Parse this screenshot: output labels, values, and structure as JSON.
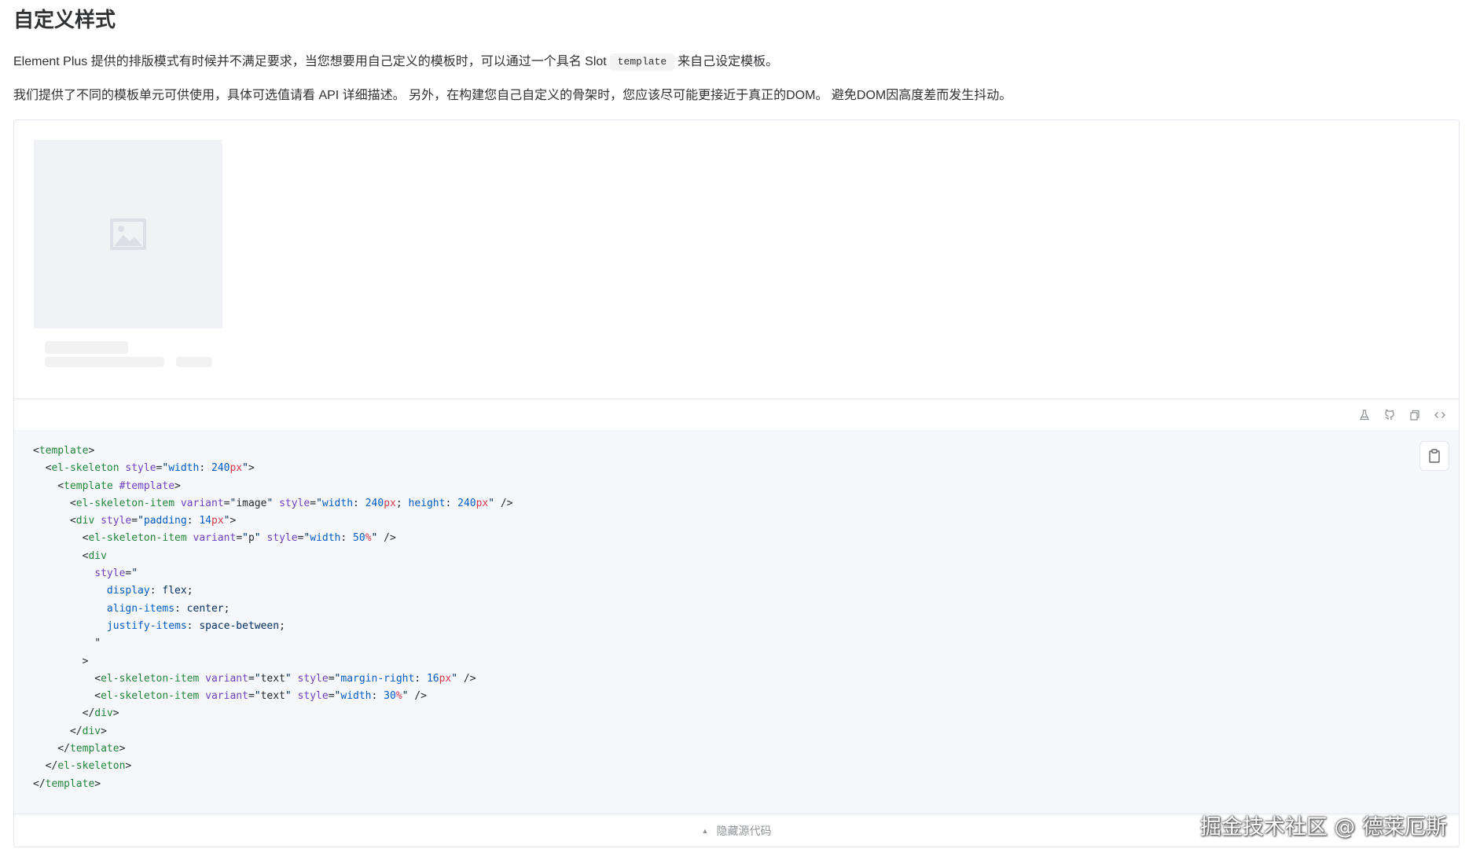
{
  "page": {
    "title": "自定义样式",
    "intro_before": "Element Plus 提供的排版模式有时候并不满足要求，当您想要用自己定义的模板时，可以通过一个具名 Slot",
    "intro_code": "template",
    "intro_after": "来自己设定模板。",
    "paragraph2": "我们提供了不同的模板单元可供使用，具体可选值请看 API 详细描述。 另外，在构建您自己自定义的骨架时，您应该尽可能更接近于真正的DOM。 避免DOM因高度差而发生抖动。"
  },
  "demo": {
    "toolbar_icons": [
      "flask-icon",
      "github-icon",
      "copy-icon",
      "code-icon"
    ],
    "code_lines": [
      "<template>",
      "  <el-skeleton style=\"width: 240px\">",
      "    <template #template>",
      "      <el-skeleton-item variant=\"image\" style=\"width: 240px; height: 240px\" />",
      "      <div style=\"padding: 14px\">",
      "        <el-skeleton-item variant=\"p\" style=\"width: 50%\" />",
      "        <div",
      "          style=\"",
      "            display: flex;",
      "            align-items: center;",
      "            justify-items: space-between;",
      "          \"",
      "        >",
      "          <el-skeleton-item variant=\"text\" style=\"margin-right: 16px\" />",
      "          <el-skeleton-item variant=\"text\" style=\"width: 30%\" />",
      "        </div>",
      "      </div>",
      "    </template>",
      "  </el-skeleton>",
      "</template>"
    ],
    "footer_label": "隐藏源代码"
  },
  "watermark": "掘金技术社区 @ 德莱厄斯"
}
